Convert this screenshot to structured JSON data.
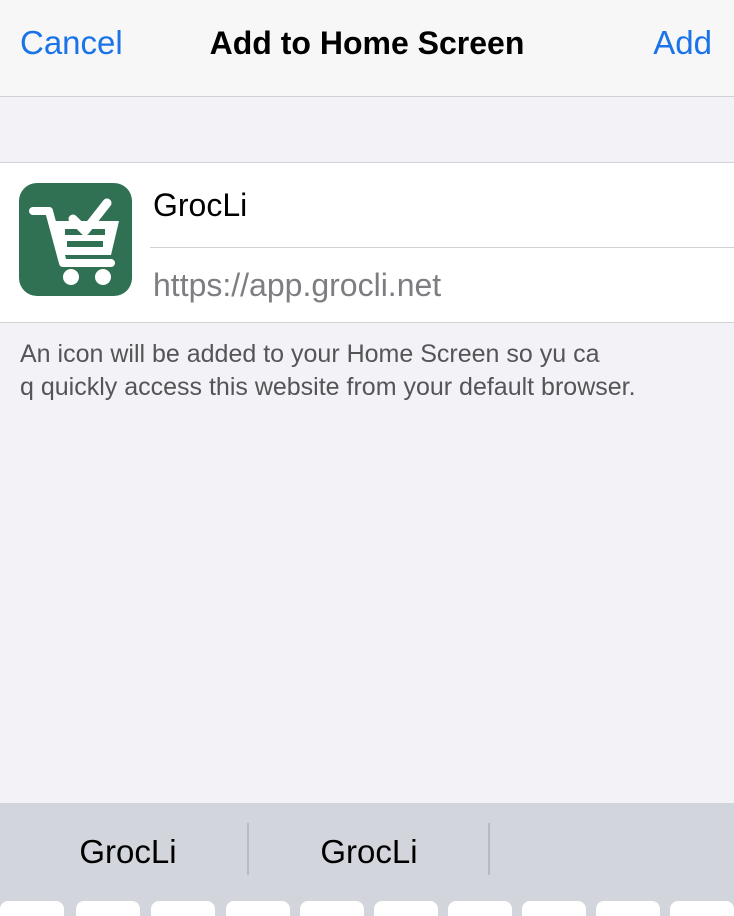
{
  "nav": {
    "cancel": "Cancel",
    "title": "Add to Home Screen",
    "add": "Add"
  },
  "app": {
    "name": "GrocLi",
    "url": "https://app.grocli.net",
    "icon": "shopping-cart-check-icon",
    "icon_color": "#2f7152"
  },
  "description": {
    "line1": "An icon will be added to your Home Screen so yu ca",
    "line2": "q quickly access this website from your default browser."
  },
  "keyboard": {
    "suggestions": [
      "GrocLi",
      "GrocLi",
      ""
    ]
  },
  "colors": {
    "accent": "#1a73e8",
    "background": "#f2f2f7",
    "keyboard_bar": "#d2d5db"
  }
}
